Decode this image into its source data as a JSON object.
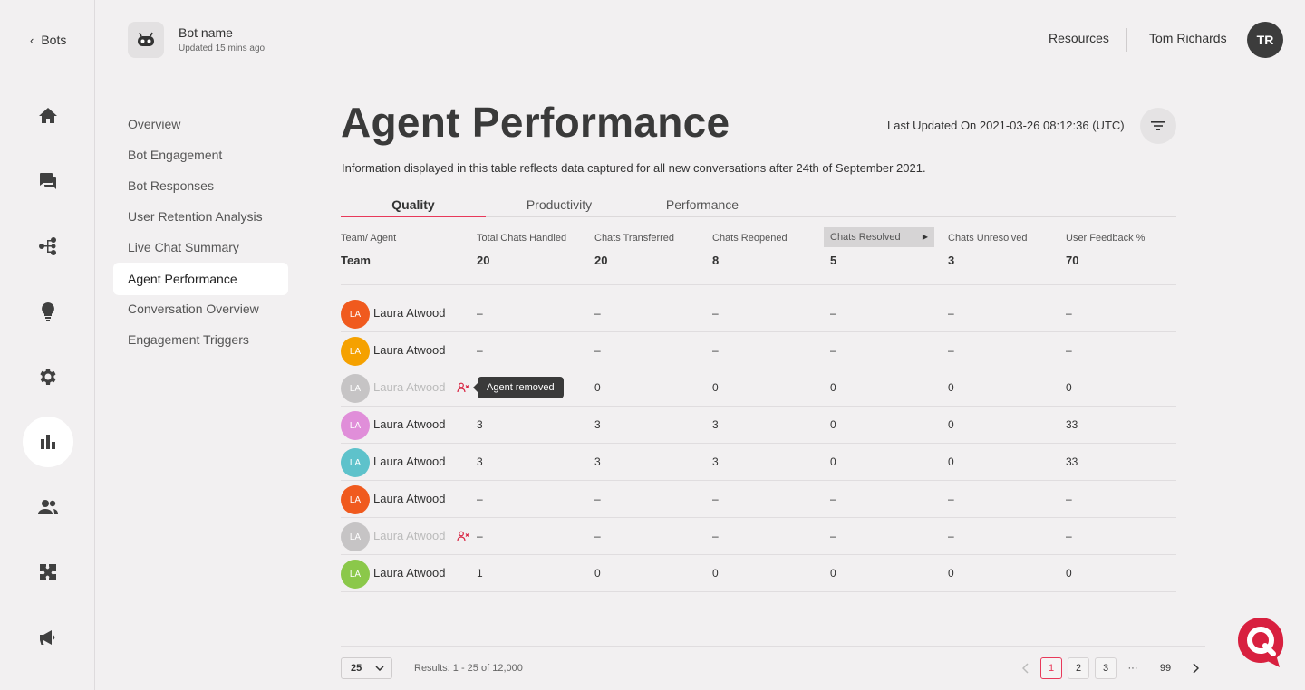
{
  "rail": {
    "back_label": "Bots",
    "icons": [
      "home-icon",
      "chat-icon",
      "flow-icon",
      "lightbulb-icon",
      "settings-icon",
      "analytics-icon",
      "users-icon",
      "integrations-icon",
      "megaphone-icon"
    ],
    "active": "analytics-icon"
  },
  "header": {
    "bot_name": "Bot name",
    "bot_updated": "Updated 15 mins ago",
    "resources": "Resources",
    "user_name": "Tom Richards",
    "user_initials": "TR"
  },
  "subnav": {
    "items": [
      "Overview",
      "Bot Engagement",
      "Bot Responses",
      "User Retention Analysis",
      "Live Chat Summary",
      "Agent Performance",
      "Conversation Overview",
      "Engagement Triggers"
    ],
    "active": "Agent Performance"
  },
  "page": {
    "title": "Agent Performance",
    "last_updated": "Last Updated On 2021-03-26 08:12:36 (UTC)",
    "info": "Information displayed in this table reflects data captured for all new conversations after 24th of September 2021."
  },
  "tabs": [
    "Quality",
    "Productivity",
    "Performance"
  ],
  "active_tab": "Quality",
  "table": {
    "headers": [
      "Team/ Agent",
      "Total Chats Handled",
      "Chats Transferred",
      "Chats Reopened",
      "Chats Resolved",
      "Chats Unresolved",
      "User Feedback %"
    ],
    "sorted_column": "Chats Resolved",
    "team_row": [
      "Team",
      "20",
      "20",
      "8",
      "5",
      "3",
      "70"
    ],
    "rows": [
      {
        "initials": "LA",
        "name": "Laura Atwood",
        "color": "#f05a1e",
        "removed": false,
        "values": [
          "–",
          "–",
          "–",
          "–",
          "–",
          "–"
        ]
      },
      {
        "initials": "LA",
        "name": "Laura Atwood",
        "color": "#f5a100",
        "removed": false,
        "values": [
          "–",
          "–",
          "–",
          "–",
          "–",
          "–"
        ]
      },
      {
        "initials": "LA",
        "name": "Laura Atwood",
        "color": "#c6c4c5",
        "removed": true,
        "values": [
          "",
          "0",
          "0",
          "0",
          "0",
          "0"
        ]
      },
      {
        "initials": "LA",
        "name": "Laura Atwood",
        "color": "#e08ed9",
        "removed": false,
        "values": [
          "3",
          "3",
          "3",
          "0",
          "0",
          "33"
        ]
      },
      {
        "initials": "LA",
        "name": "Laura Atwood",
        "color": "#5ec2cb",
        "removed": false,
        "values": [
          "3",
          "3",
          "3",
          "0",
          "0",
          "33"
        ]
      },
      {
        "initials": "LA",
        "name": "Laura Atwood",
        "color": "#f05a1e",
        "removed": false,
        "values": [
          "–",
          "–",
          "–",
          "–",
          "–",
          "–"
        ]
      },
      {
        "initials": "LA",
        "name": "Laura Atwood",
        "color": "#c6c4c5",
        "removed": true,
        "values": [
          "–",
          "–",
          "–",
          "–",
          "–",
          "–"
        ]
      },
      {
        "initials": "LA",
        "name": "Laura Atwood",
        "color": "#8bc84a",
        "removed": false,
        "values": [
          "1",
          "0",
          "0",
          "0",
          "0",
          "0"
        ]
      }
    ],
    "tooltip": "Agent removed"
  },
  "footer": {
    "page_size": "25",
    "results": "Results: 1 - 25 of 12,000",
    "pages": [
      "1",
      "2",
      "3",
      "···",
      "99"
    ],
    "current_page": "1"
  },
  "colors": {
    "accent": "#e8395a",
    "brand": "#d8203f",
    "background": "#f2f0f1"
  }
}
